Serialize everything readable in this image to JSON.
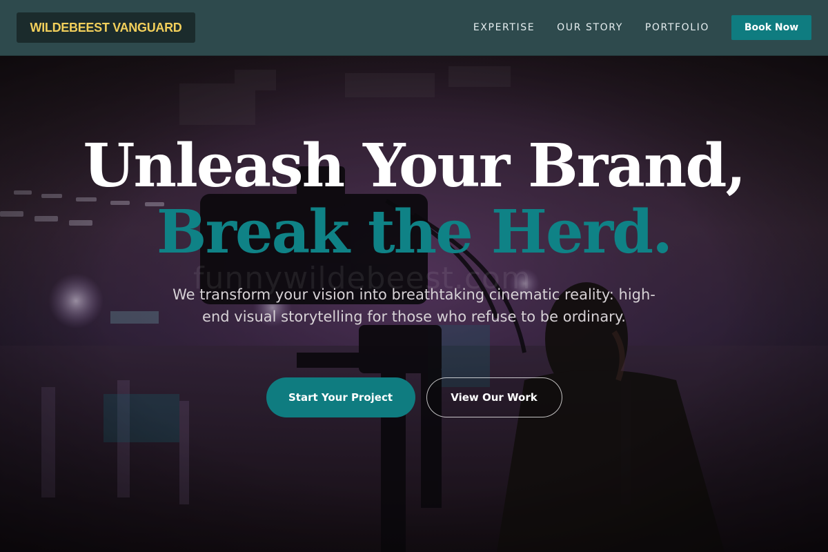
{
  "header": {
    "logo_text": "WILDEBEEST VANGUARD",
    "nav": [
      {
        "label": "EXPERTISE"
      },
      {
        "label": "OUR STORY"
      },
      {
        "label": "PORTFOLIO"
      }
    ],
    "book_label": "Book Now"
  },
  "hero": {
    "headline_line1": "Unleash Your Brand,",
    "headline_line2": "Break the Herd.",
    "subtitle": "We transform your vision into breathtaking cinematic reality: high-end visual storytelling for those who refuse to be ordinary.",
    "primary_cta": "Start Your Project",
    "secondary_cta": "View Our Work",
    "watermark": "funnywildebeest.com",
    "background_image": "camera-operator-film-set-photo"
  },
  "colors": {
    "header_bg": "#2e4a4d",
    "logo_bg": "#1b2b2c",
    "logo_text": "#f2cf5b",
    "accent_teal": "#0f7c80",
    "headline_white": "#ffffff",
    "subtitle": "#d7d2d6"
  }
}
